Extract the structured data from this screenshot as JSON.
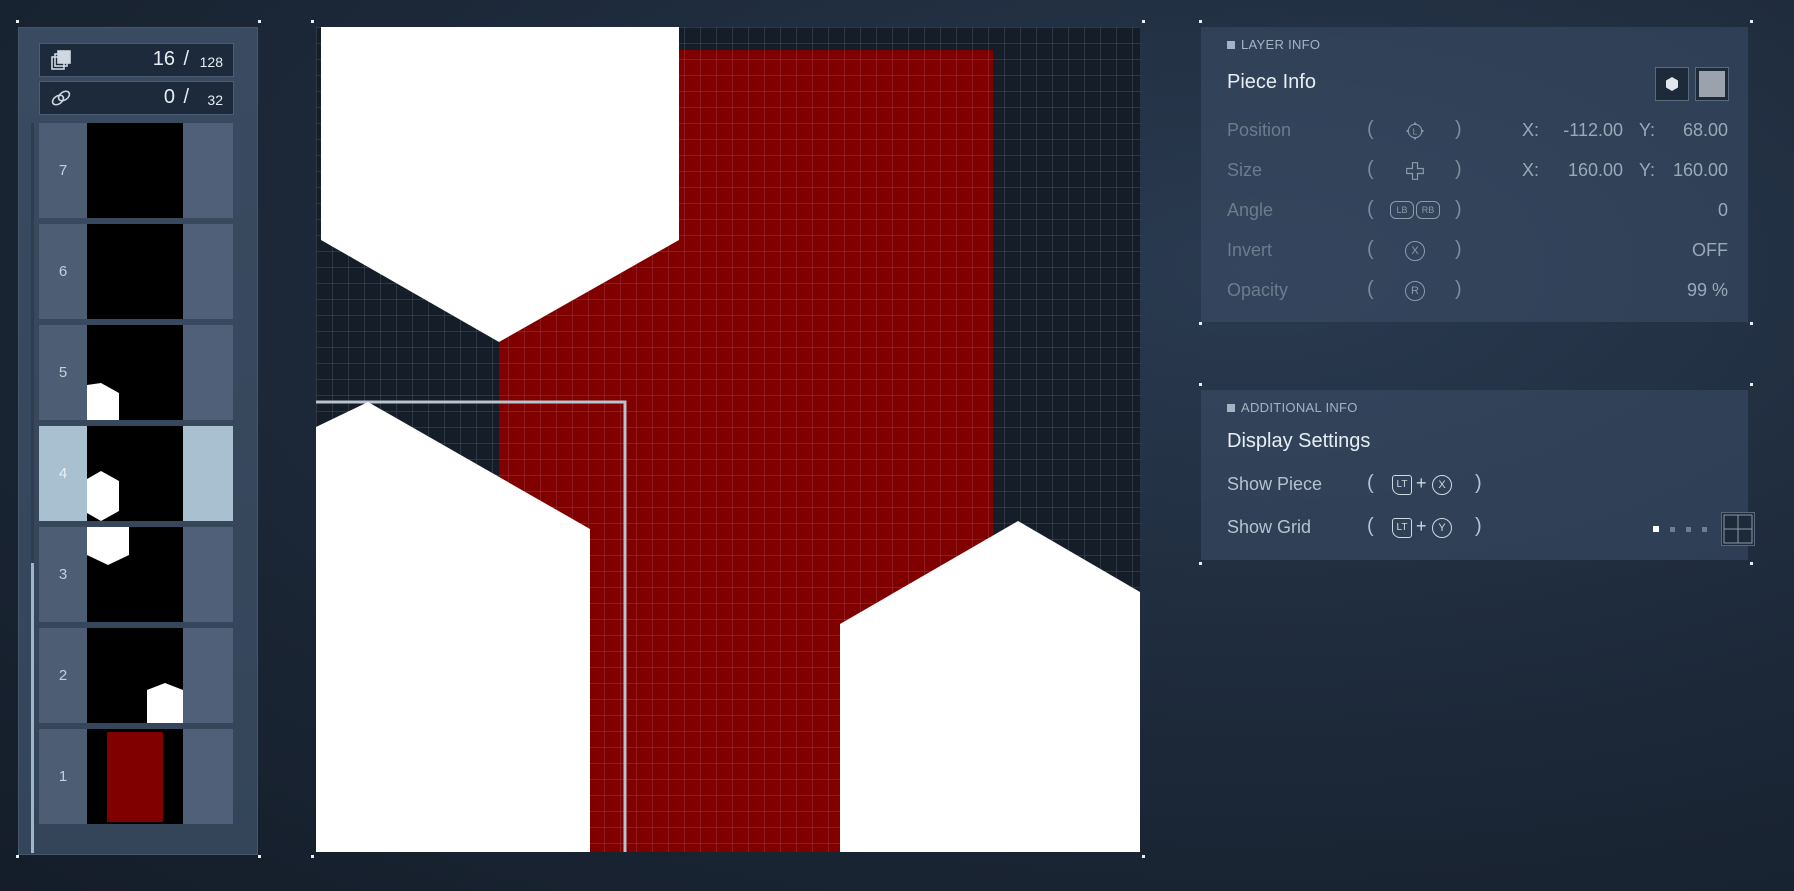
{
  "layers_panel": {
    "piece_count": "16",
    "piece_max": "128",
    "link_count": "0",
    "link_max": "32",
    "separator": "/",
    "rows": [
      {
        "num": "7"
      },
      {
        "num": "6"
      },
      {
        "num": "5"
      },
      {
        "num": "4"
      },
      {
        "num": "3"
      },
      {
        "num": "2"
      },
      {
        "num": "1"
      }
    ],
    "selected_layer": "4"
  },
  "canvas": {
    "background_color": "#151d28",
    "red_color": "#800000",
    "piece_color": "#ffffff",
    "grid_visible": true
  },
  "layer_info": {
    "tag": "LAYER INFO",
    "title": "Piece Info",
    "position": {
      "label": "Position",
      "x_label": "X:",
      "x": "-112.00",
      "y_label": "Y:",
      "y": "68.00"
    },
    "size": {
      "label": "Size",
      "x_label": "X:",
      "x": "160.00",
      "y_label": "Y:",
      "y": "160.00"
    },
    "angle": {
      "label": "Angle",
      "value": "0",
      "btn1": "LB",
      "btn2": "RB"
    },
    "invert": {
      "label": "Invert",
      "value": "OFF",
      "btn": "X"
    },
    "opacity": {
      "label": "Opacity",
      "value": "99 %",
      "btn": "R"
    },
    "open_paren": "(",
    "close_paren": ")"
  },
  "additional_info": {
    "tag": "ADDITIONAL INFO",
    "title": "Display Settings",
    "show_piece": {
      "label": "Show Piece",
      "btn1": "LT",
      "plus": "+",
      "btn2": "X"
    },
    "show_grid": {
      "label": "Show Grid",
      "btn1": "LT",
      "plus": "+",
      "btn2": "Y"
    }
  }
}
